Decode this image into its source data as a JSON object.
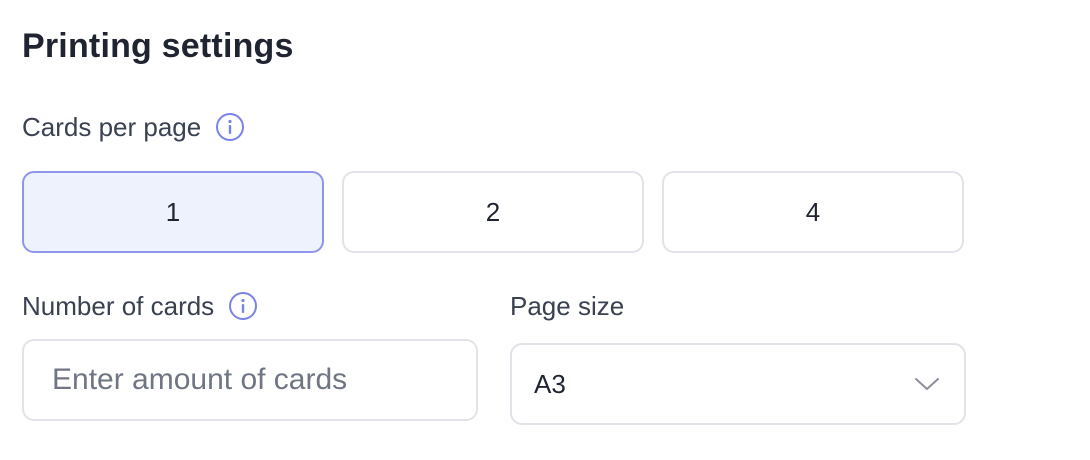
{
  "section": {
    "title": "Printing settings"
  },
  "cards_per_page": {
    "label": "Cards per page",
    "options": [
      "1",
      "2",
      "4"
    ],
    "selected": "1"
  },
  "number_of_cards": {
    "label": "Number of cards",
    "placeholder": "Enter amount of cards",
    "value": ""
  },
  "page_size": {
    "label": "Page size",
    "selected_value": "A3"
  },
  "icons": {
    "info": "info-circle-icon",
    "dropdown": "chevron-down-icon"
  },
  "colors": {
    "accent": "#7b83e6",
    "selected_bg": "#eef2fd",
    "border": "#e1e3e8"
  }
}
